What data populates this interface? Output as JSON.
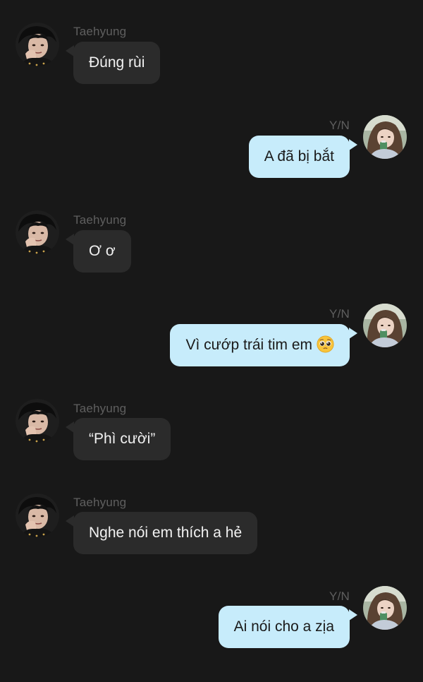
{
  "messages": [
    {
      "sender": "Taehyung",
      "text": "Đúng rùi",
      "avatar_icon": "taehyung-avatar-icon"
    },
    {
      "sender": "Y/N",
      "text": "A đã bị bắt",
      "avatar_icon": "yn-avatar-icon"
    },
    {
      "sender": "Taehyung",
      "text": "Ơ ơ",
      "avatar_icon": "taehyung-avatar-icon"
    },
    {
      "sender": "Y/N",
      "text": "Vì cướp trái tim em",
      "emoji": "pleading-face-emoji",
      "avatar_icon": "yn-avatar-icon"
    },
    {
      "sender": "Taehyung",
      "text": "“Phì cười”",
      "avatar_icon": "taehyung-avatar-icon"
    },
    {
      "sender": "Taehyung",
      "text": "Nghe nói em thích a hẻ",
      "avatar_icon": "taehyung-avatar-icon"
    },
    {
      "sender": "Y/N",
      "text": "Ai nói cho a zịa",
      "avatar_icon": "yn-avatar-icon"
    }
  ],
  "colors": {
    "background": "#181818",
    "incoming_bubble": "#2b2b2b",
    "outgoing_bubble": "#c7ecfb",
    "sender_name": "#5f5f5f"
  }
}
